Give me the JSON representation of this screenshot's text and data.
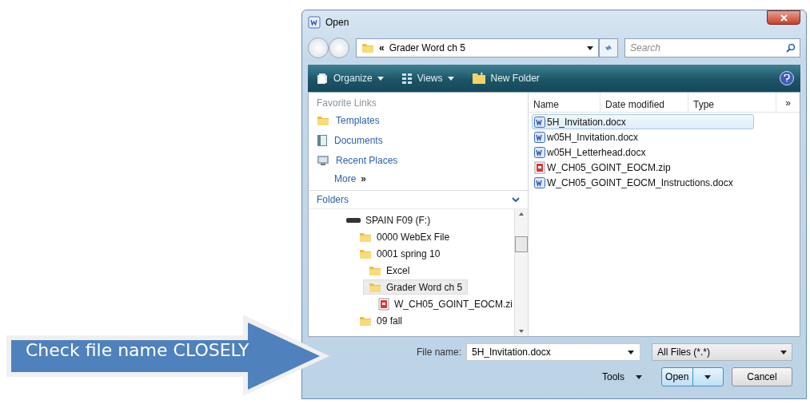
{
  "window": {
    "title": "Open"
  },
  "address": {
    "prefix": "«",
    "path": "Grader Word ch 5"
  },
  "search": {
    "placeholder": "Search"
  },
  "toolbar": [
    {
      "label": "Organize",
      "kind": "organize"
    },
    {
      "label": "Views",
      "kind": "views"
    },
    {
      "label": "New Folder",
      "kind": "new-folder"
    }
  ],
  "favorite_links": {
    "heading": "Favorite Links",
    "items": [
      {
        "label": "Templates",
        "kind": "folder"
      },
      {
        "label": "Documents",
        "kind": "documents"
      },
      {
        "label": "Recent Places",
        "kind": "recent"
      }
    ],
    "more": "More",
    "more_glyph": "»"
  },
  "folders": {
    "heading": "Folders",
    "tree": [
      {
        "label": "SPAIN F09 (F:)",
        "kind": "drive",
        "selected": false,
        "children": [
          {
            "label": "0000 WebEx File",
            "kind": "folder",
            "selected": false
          },
          {
            "label": "0001 spring 10",
            "kind": "folder",
            "selected": false,
            "children": [
              {
                "label": "Excel",
                "kind": "folder",
                "selected": false
              },
              {
                "label": "Grader Word ch 5",
                "kind": "folder",
                "selected": true,
                "children": [
                  {
                    "label": "W_CH05_GOINT_EOCM.zi",
                    "kind": "zip",
                    "selected": false
                  }
                ]
              }
            ]
          },
          {
            "label": "09 fall",
            "kind": "folder",
            "selected": false
          }
        ]
      }
    ]
  },
  "file_list": {
    "columns": [
      "Name",
      "Date modified",
      "Type"
    ],
    "more_glyph": "»",
    "files": [
      {
        "name": "5H_Invitation.docx",
        "kind": "doc",
        "selected": true
      },
      {
        "name": "w05H_Invitation.docx",
        "kind": "doc",
        "selected": false
      },
      {
        "name": "w05H_Letterhead.docx",
        "kind": "doc",
        "selected": false
      },
      {
        "name": "W_CH05_GOINT_EOCM.zip",
        "kind": "zip",
        "selected": false
      },
      {
        "name": "W_CH05_GOINT_EOCM_Instructions.docx",
        "kind": "doc",
        "selected": false
      }
    ]
  },
  "file_name": {
    "label": "File name:",
    "value": "5H_Invitation.docx"
  },
  "file_type": {
    "value": "All Files (*.*)"
  },
  "tools": "Tools",
  "buttons": {
    "open": "Open",
    "cancel": "Cancel"
  },
  "callout": {
    "text": "Check file name CLOSELY"
  }
}
